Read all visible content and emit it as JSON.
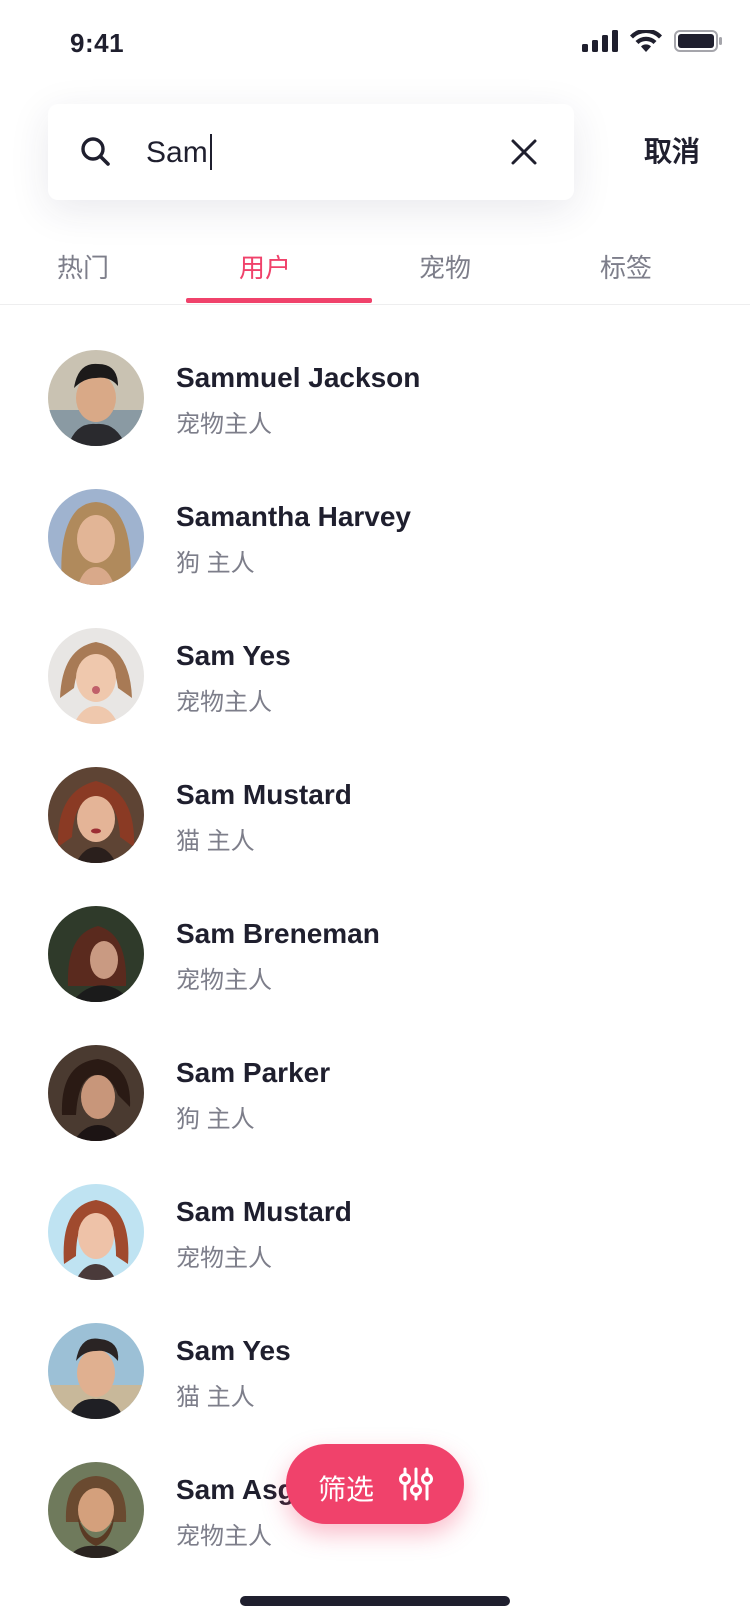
{
  "status_bar": {
    "time": "9:41"
  },
  "search": {
    "value": "Sam",
    "cancel_label": "取消"
  },
  "tabs": [
    {
      "label": "热门"
    },
    {
      "label": "用户"
    },
    {
      "label": "宠物"
    },
    {
      "label": "标签"
    }
  ],
  "active_tab": "用户",
  "users": [
    {
      "name": "Sammuel Jackson",
      "role": "宠物主人"
    },
    {
      "name": "Samantha Harvey",
      "role": "狗 主人"
    },
    {
      "name": "Sam Yes",
      "role": "宠物主人"
    },
    {
      "name": "Sam Mustard",
      "role": "猫 主人"
    },
    {
      "name": "Sam Breneman",
      "role": "宠物主人"
    },
    {
      "name": "Sam Parker",
      "role": "狗 主人"
    },
    {
      "name": "Sam Mustard",
      "role": "宠物主人"
    },
    {
      "name": "Sam Yes",
      "role": "猫 主人"
    },
    {
      "name": "Sam Asghri",
      "role": "宠物主人"
    }
  ],
  "filter": {
    "label": "筛选"
  },
  "colors": {
    "accent": "#f0426b",
    "text": "#1f1f2e",
    "muted": "#7d7e8a"
  }
}
